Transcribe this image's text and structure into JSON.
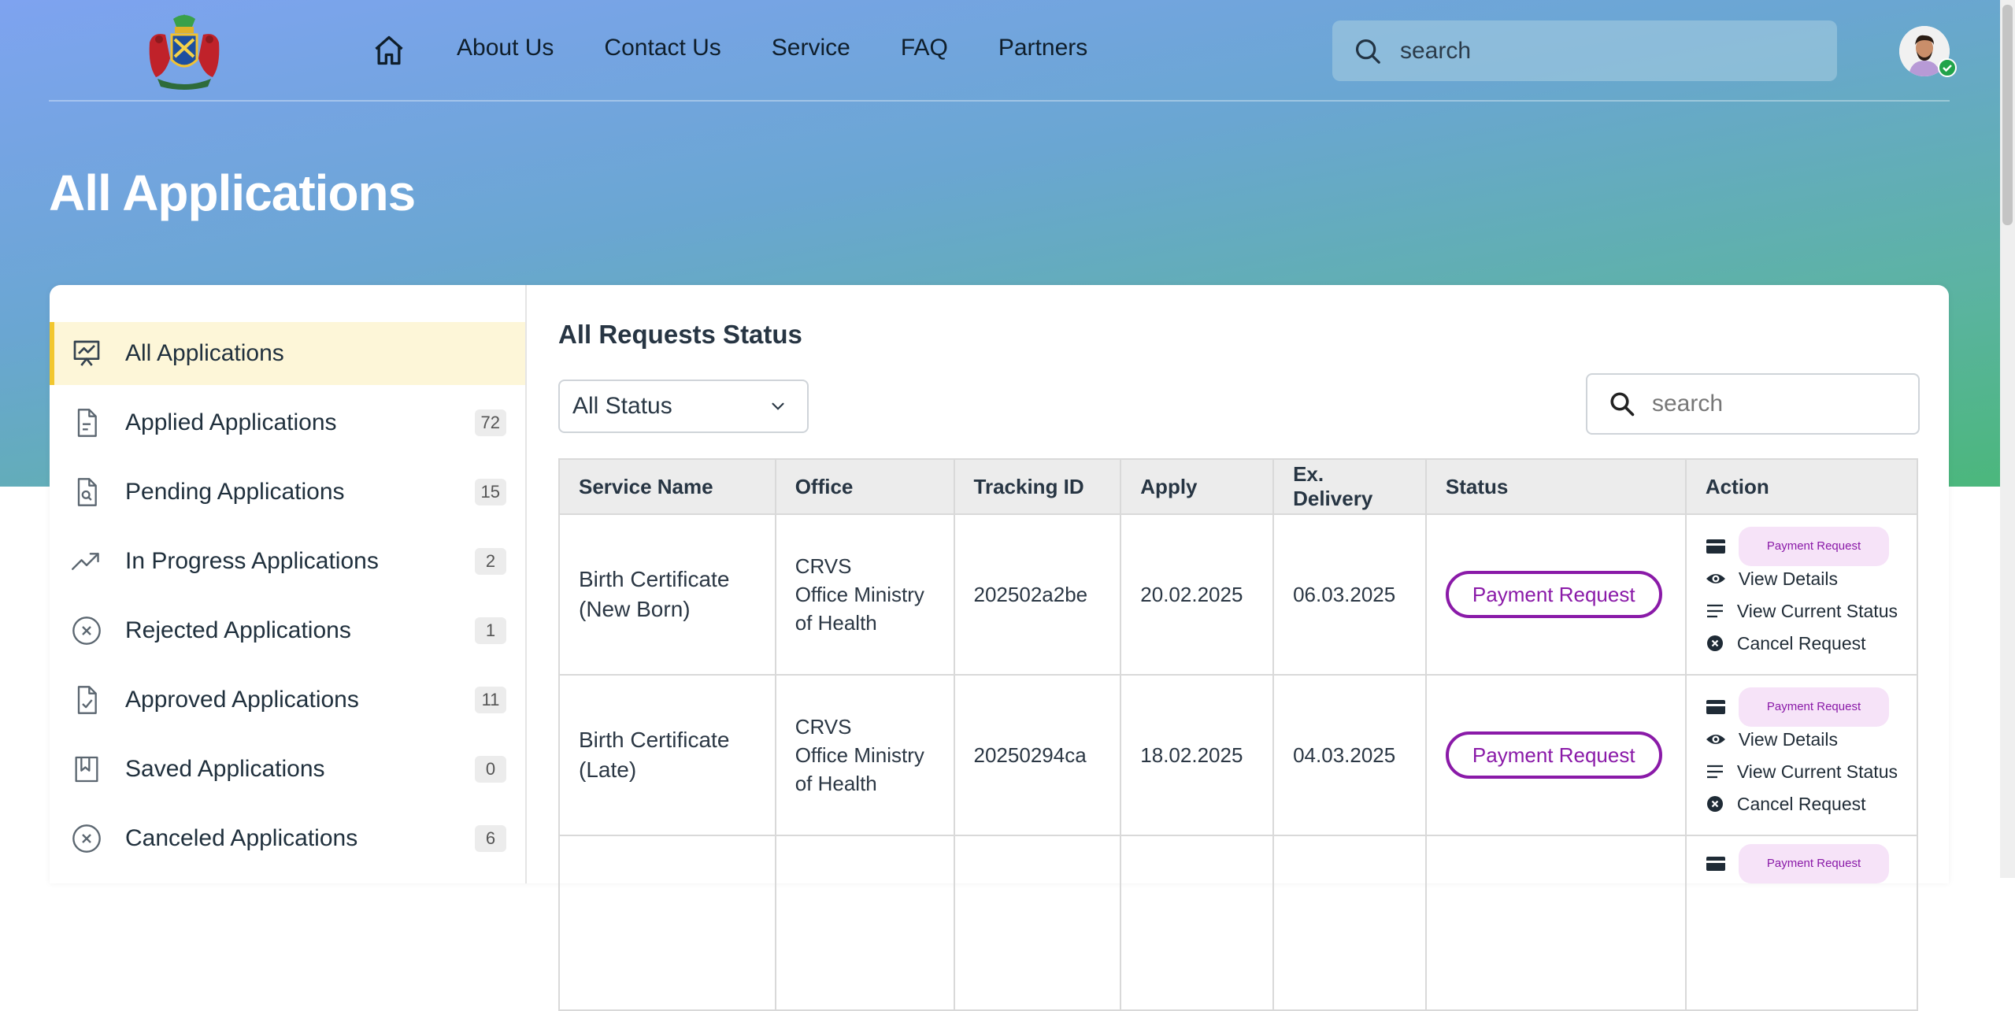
{
  "nav": {
    "links": [
      "About Us",
      "Contact Us",
      "Service",
      "FAQ",
      "Partners"
    ],
    "search_placeholder": "search",
    "icons": [
      "coat-of-arms-logo",
      "home-icon",
      "search-icon",
      "avatar",
      "verified-badge-icon"
    ]
  },
  "page": {
    "title": "All Applications"
  },
  "sidebar": {
    "items": [
      {
        "label": "All Applications",
        "icon": "presentation-chart-icon",
        "count": ""
      },
      {
        "label": "Applied Applications",
        "icon": "document-icon",
        "count": "72"
      },
      {
        "label": "Pending Applications",
        "icon": "document-search-icon",
        "count": "15"
      },
      {
        "label": "In Progress Applications",
        "icon": "trending-up-icon",
        "count": "2"
      },
      {
        "label": "Rejected Applications",
        "icon": "circle-x-icon",
        "count": "1"
      },
      {
        "label": "Approved Applications",
        "icon": "document-check-icon",
        "count": "11"
      },
      {
        "label": "Saved Applications",
        "icon": "bookmark-icon",
        "count": "0"
      },
      {
        "label": "Canceled Applications",
        "icon": "circle-x-icon",
        "count": "6"
      }
    ]
  },
  "main": {
    "title": "All Requests Status",
    "status_filter": "All Status",
    "search_placeholder": "search",
    "columns": [
      "Service Name",
      "Office",
      "Tracking ID",
      "Apply",
      "Ex. Delivery",
      "Status",
      "Action"
    ],
    "rows": [
      {
        "service": [
          "Birth Certificate",
          "(New Born)"
        ],
        "office": [
          "CRVS",
          "Office Ministry",
          "of Health"
        ],
        "tracking_id": "202502a2be",
        "apply": "20.02.2025",
        "delivery": "06.03.2025",
        "status": "Payment Request"
      },
      {
        "service": [
          "Birth Certificate",
          "(Late)"
        ],
        "office": [
          "CRVS",
          "Office Ministry",
          "of Health"
        ],
        "tracking_id": "20250294ca",
        "apply": "18.02.2025",
        "delivery": "04.03.2025",
        "status": "Payment Request"
      }
    ],
    "actions": {
      "payment": "Payment Request",
      "view_details": "View Details",
      "view_status": "View Current Status",
      "cancel": "Cancel Request"
    }
  },
  "colors": {
    "accent_purple": "#8a1aa8",
    "active_bar": "#f2c72e",
    "active_bg": "#fdf6d8"
  }
}
